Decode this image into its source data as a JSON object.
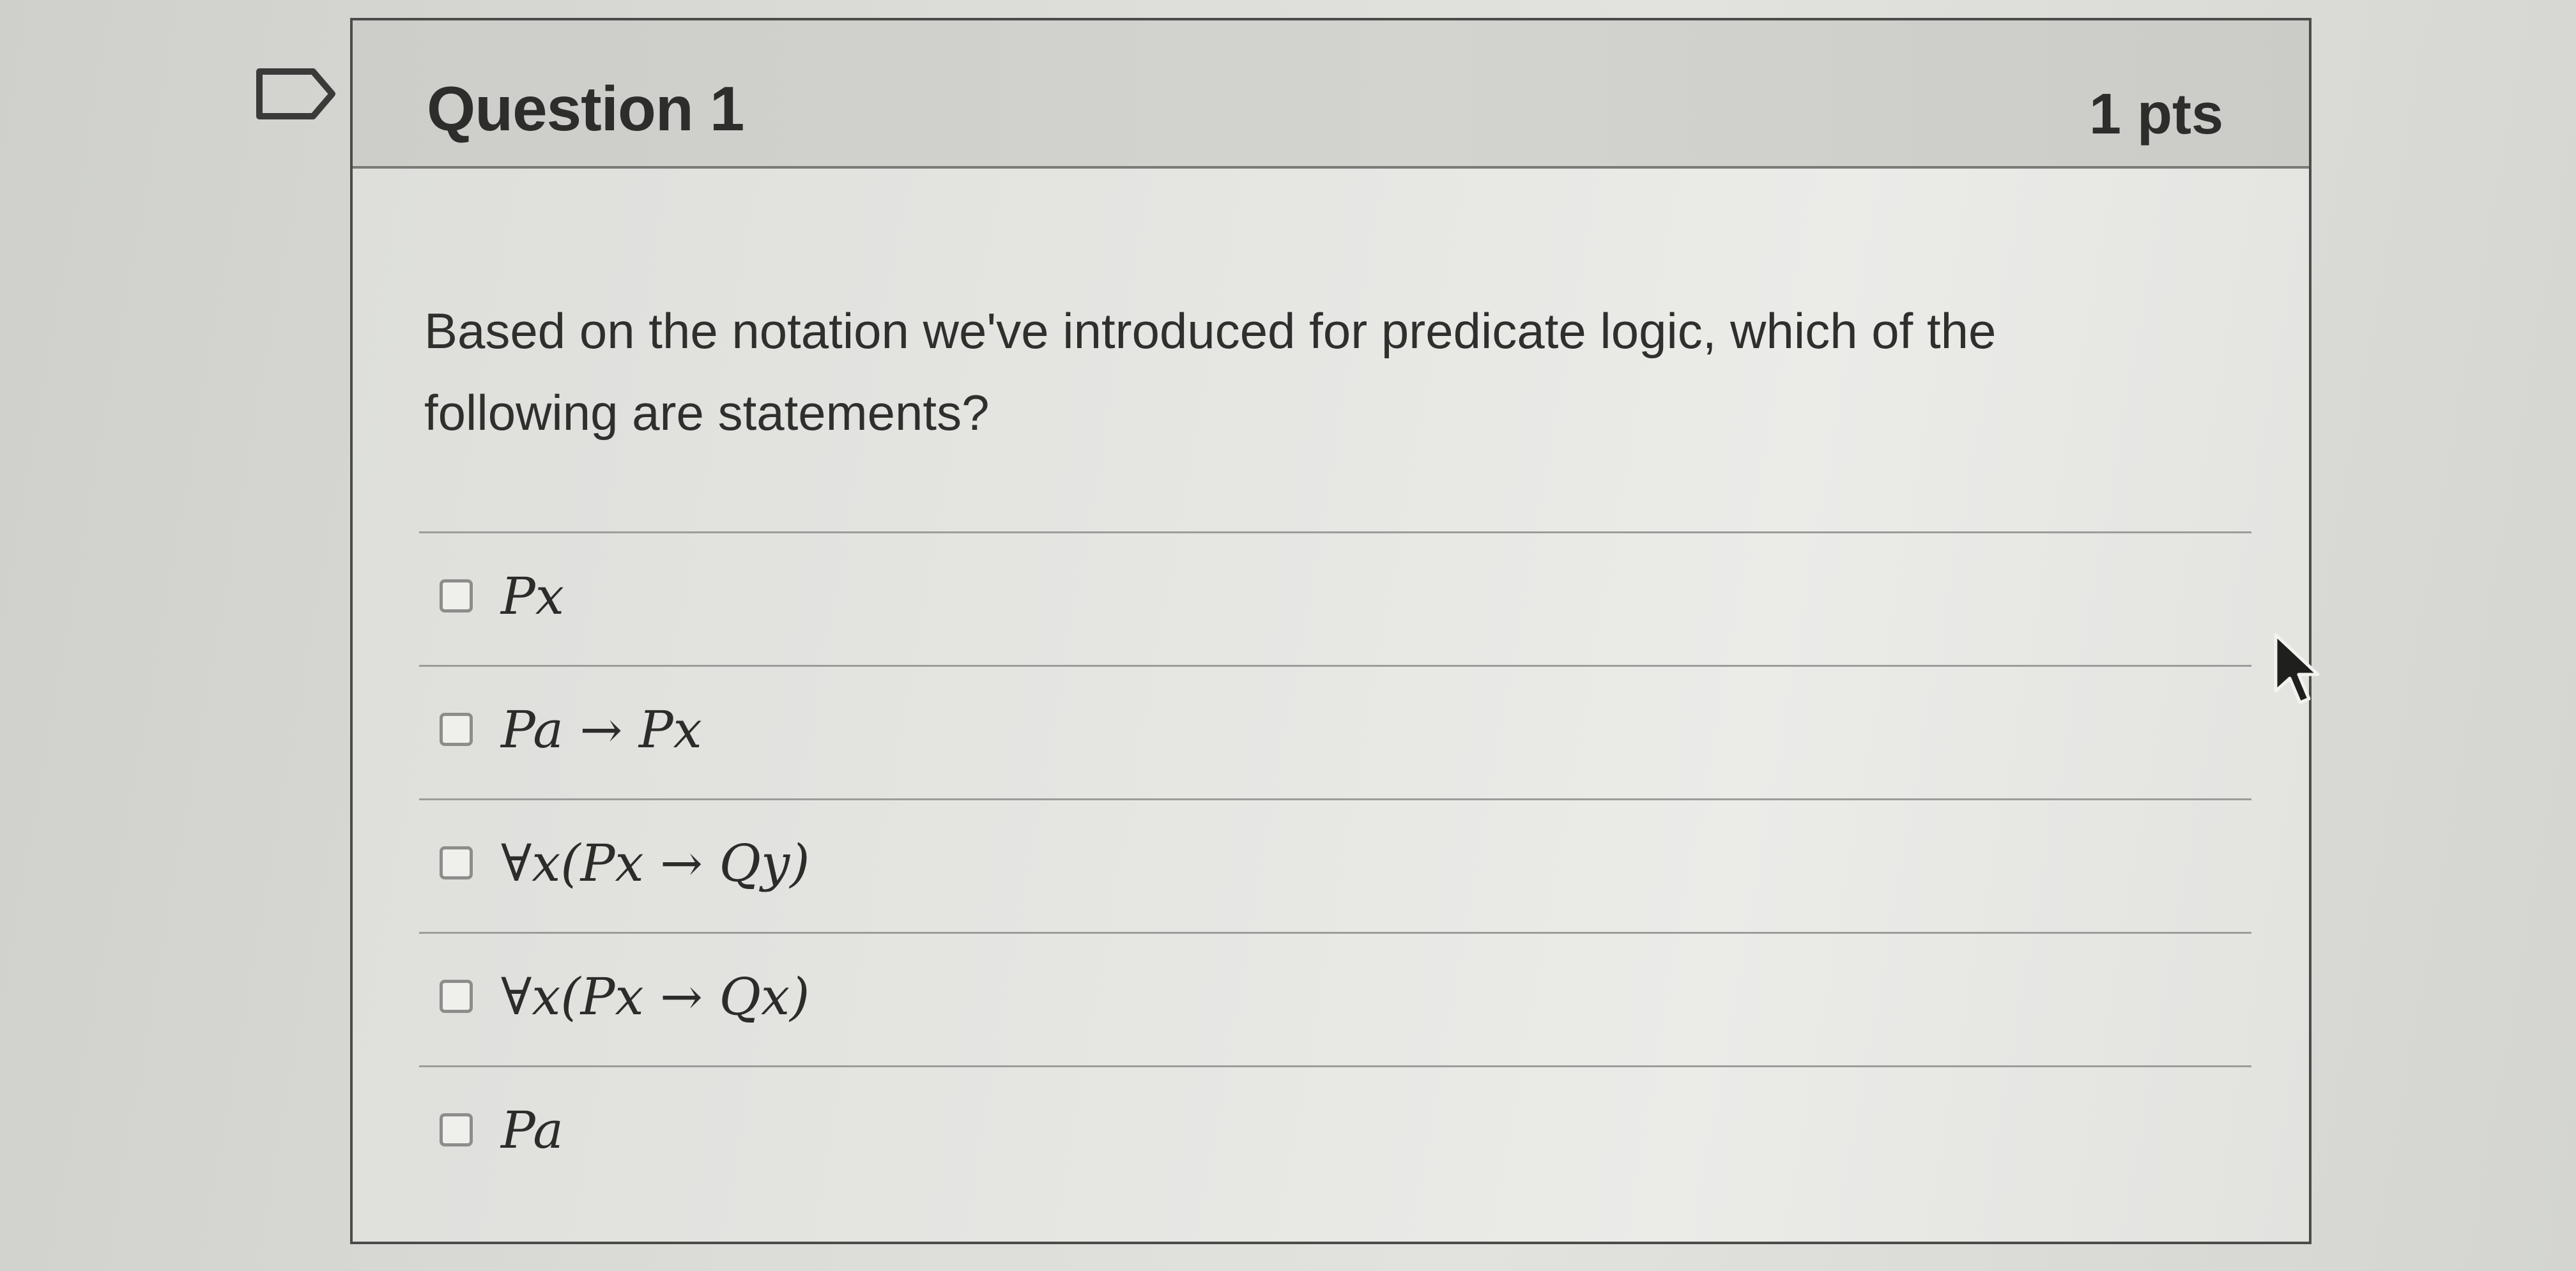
{
  "question": {
    "title": "Question 1",
    "points": "1 pts",
    "text": "Based on the notation we've introduced for predicate logic, which of the following are statements?"
  },
  "answers": [
    {
      "label": "Px",
      "checked": false
    },
    {
      "label": "Pa → Px",
      "checked": false
    },
    {
      "label": "∀x(Px → Qy)",
      "checked": false
    },
    {
      "label": "∀x(Px → Qx)",
      "checked": false
    },
    {
      "label": "Pa",
      "checked": false
    }
  ],
  "icons": {
    "flag": "flag-icon",
    "cursor": "mouse-cursor-icon",
    "checkbox": "checkbox-icon"
  },
  "colors": {
    "header_background": "#cfd0cc",
    "body_background": "#e6e6e3",
    "text": "#2d2e2c",
    "border": "#4b4c4a"
  }
}
